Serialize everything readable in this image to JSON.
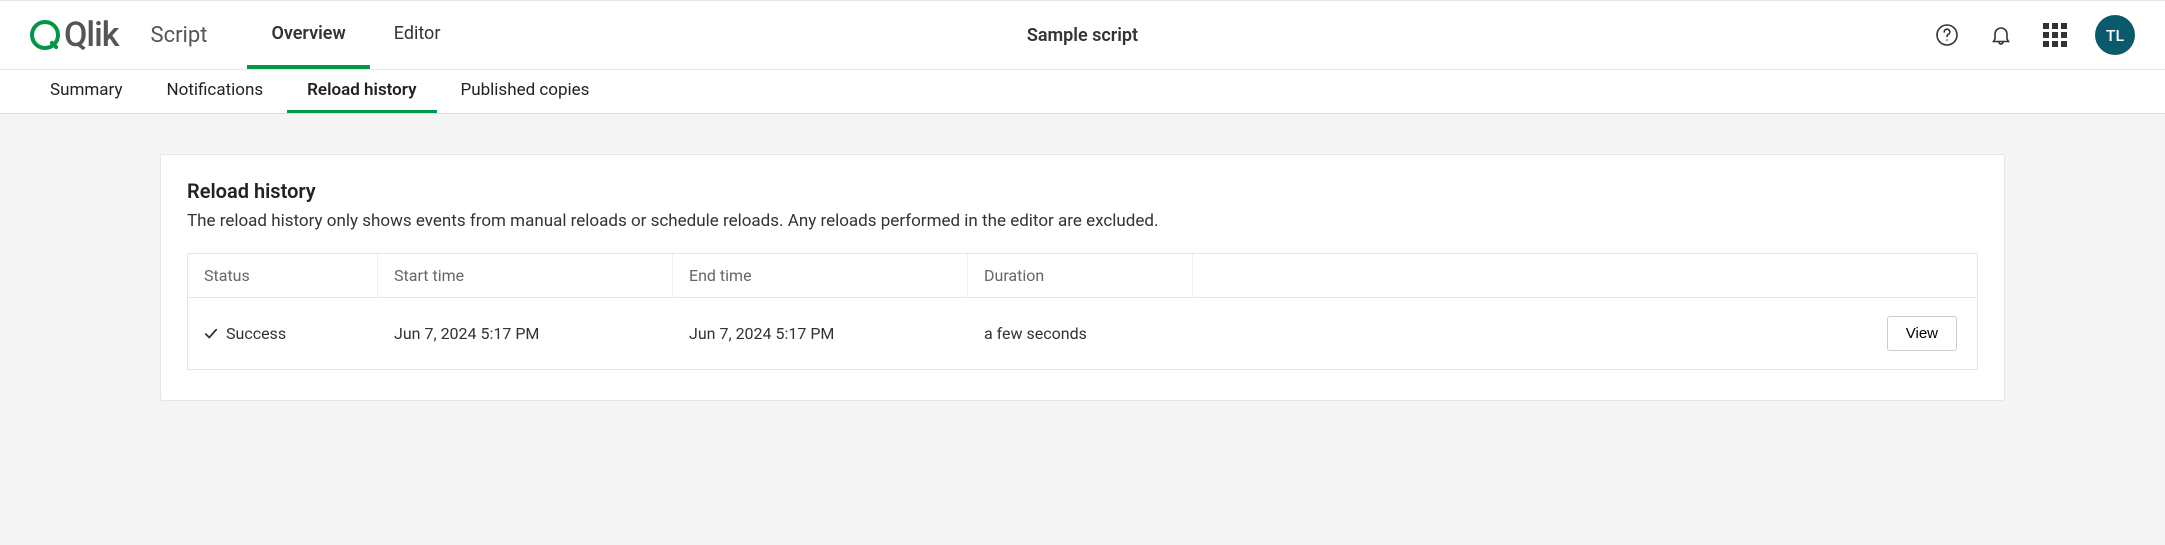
{
  "brand": {
    "name": "Qlik"
  },
  "header": {
    "app_type": "Script",
    "primary_tabs": [
      {
        "label": "Overview",
        "active": true
      },
      {
        "label": "Editor",
        "active": false
      }
    ],
    "doc_title": "Sample script",
    "avatar_initials": "TL"
  },
  "sub_tabs": [
    {
      "label": "Summary",
      "active": false
    },
    {
      "label": "Notifications",
      "active": false
    },
    {
      "label": "Reload history",
      "active": true
    },
    {
      "label": "Published copies",
      "active": false
    }
  ],
  "panel": {
    "title": "Reload history",
    "description": "The reload history only shows events from manual reloads or schedule reloads. Any reloads performed in the editor are excluded.",
    "columns": {
      "status": "Status",
      "start": "Start time",
      "end": "End time",
      "duration": "Duration"
    },
    "rows": [
      {
        "status": "Success",
        "start_time": "Jun 7, 2024 5:17 PM",
        "end_time": "Jun 7, 2024 5:17 PM",
        "duration": "a few seconds",
        "action": "View"
      }
    ]
  }
}
